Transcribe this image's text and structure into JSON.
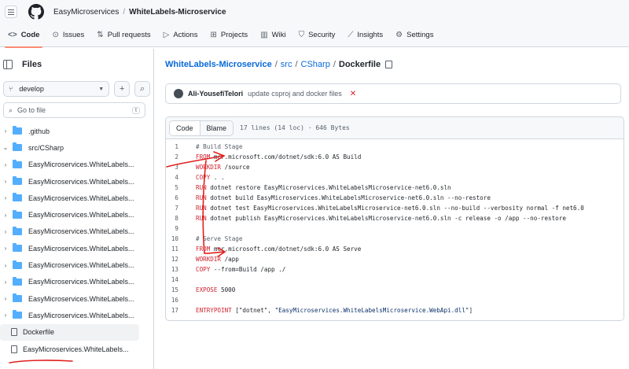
{
  "header": {
    "owner": "EasyMicroservices",
    "separator": "/",
    "repo": "WhiteLabels-Microservice"
  },
  "tabs": [
    {
      "label": "Code",
      "icon": "code-icon"
    },
    {
      "label": "Issues",
      "icon": "issue-icon"
    },
    {
      "label": "Pull requests",
      "icon": "pull-request-icon"
    },
    {
      "label": "Actions",
      "icon": "play-icon"
    },
    {
      "label": "Projects",
      "icon": "table-icon"
    },
    {
      "label": "Wiki",
      "icon": "book-icon"
    },
    {
      "label": "Security",
      "icon": "shield-icon"
    },
    {
      "label": "Insights",
      "icon": "graph-icon"
    },
    {
      "label": "Settings",
      "icon": "gear-icon"
    }
  ],
  "sidebar": {
    "title": "Files",
    "branch": "develop",
    "goto_placeholder": "Go to file",
    "goto_key": "t",
    "tree": [
      {
        "label": ".github",
        "type": "folder",
        "expanded": false
      },
      {
        "label": "src/CSharp",
        "type": "folder",
        "expanded": true
      },
      {
        "label": "EasyMicroservices.WhiteLabels...",
        "type": "folder"
      },
      {
        "label": "EasyMicroservices.WhiteLabels...",
        "type": "folder"
      },
      {
        "label": "EasyMicroservices.WhiteLabels...",
        "type": "folder"
      },
      {
        "label": "EasyMicroservices.WhiteLabels...",
        "type": "folder"
      },
      {
        "label": "EasyMicroservices.WhiteLabels...",
        "type": "folder"
      },
      {
        "label": "EasyMicroservices.WhiteLabels...",
        "type": "folder"
      },
      {
        "label": "EasyMicroservices.WhiteLabels...",
        "type": "folder"
      },
      {
        "label": "EasyMicroservices.WhiteLabels...",
        "type": "folder"
      },
      {
        "label": "EasyMicroservices.WhiteLabels...",
        "type": "folder"
      },
      {
        "label": "EasyMicroservices.WhiteLabels...",
        "type": "folder"
      },
      {
        "label": "Dockerfile",
        "type": "file"
      },
      {
        "label": "EasyMicroservices.WhiteLabels...",
        "type": "file"
      }
    ]
  },
  "breadcrumb": {
    "repo": "WhiteLabels-Microservice",
    "src": "src",
    "csharp": "CSharp",
    "file": "Dockerfile"
  },
  "commit": {
    "author": "Ali-YousefiTelori",
    "message": "update csproj and docker files",
    "status": "✕"
  },
  "code_view": {
    "code_tab": "Code",
    "blame_tab": "Blame",
    "meta": "17 lines (14 loc) · 646 Bytes",
    "lines": [
      {
        "n": "1",
        "parts": [
          {
            "c": "cm",
            "t": "# Build Stage"
          }
        ]
      },
      {
        "n": "2",
        "parts": [
          {
            "c": "kw",
            "t": "FROM"
          },
          {
            "c": "txt",
            "t": " mcr.microsoft.com/dotnet/sdk:6.0 AS Build"
          }
        ]
      },
      {
        "n": "3",
        "parts": [
          {
            "c": "kw",
            "t": "WORKDIR"
          },
          {
            "c": "txt",
            "t": " /source"
          }
        ]
      },
      {
        "n": "4",
        "parts": [
          {
            "c": "kw",
            "t": "COPY"
          },
          {
            "c": "txt",
            "t": " . ."
          }
        ]
      },
      {
        "n": "5",
        "parts": [
          {
            "c": "kw",
            "t": "RUN"
          },
          {
            "c": "txt",
            "t": " dotnet restore EasyMicroservices.WhiteLabelsMicroservice-net6.0.sln"
          }
        ]
      },
      {
        "n": "6",
        "parts": [
          {
            "c": "kw",
            "t": "RUN"
          },
          {
            "c": "txt",
            "t": " dotnet build EasyMicroservices.WhiteLabelsMicroservice-net6.0.sln --no-restore"
          }
        ]
      },
      {
        "n": "7",
        "parts": [
          {
            "c": "kw",
            "t": "RUN"
          },
          {
            "c": "txt",
            "t": " dotnet test EasyMicroservices.WhiteLabelsMicroservice-net6.0.sln --no-build --verbosity normal -f net6.0"
          }
        ]
      },
      {
        "n": "8",
        "parts": [
          {
            "c": "kw",
            "t": "RUN"
          },
          {
            "c": "txt",
            "t": " dotnet publish EasyMicroservices.WhiteLabelsMicroservice-net6.0.sln -c release -o /app --no-restore"
          }
        ]
      },
      {
        "n": "9",
        "parts": []
      },
      {
        "n": "10",
        "parts": [
          {
            "c": "cm",
            "t": "# Serve Stage"
          }
        ]
      },
      {
        "n": "11",
        "parts": [
          {
            "c": "kw",
            "t": "FROM"
          },
          {
            "c": "txt",
            "t": " mcr.microsoft.com/dotnet/sdk:6.0 AS Serve"
          }
        ]
      },
      {
        "n": "12",
        "parts": [
          {
            "c": "kw",
            "t": "WORKDIR"
          },
          {
            "c": "txt",
            "t": " /app"
          }
        ]
      },
      {
        "n": "13",
        "parts": [
          {
            "c": "kw",
            "t": "COPY"
          },
          {
            "c": "txt",
            "t": " --from=Build /app ./"
          }
        ]
      },
      {
        "n": "14",
        "parts": []
      },
      {
        "n": "15",
        "parts": [
          {
            "c": "kw",
            "t": "EXPOSE"
          },
          {
            "c": "txt",
            "t": " 5000"
          }
        ]
      },
      {
        "n": "16",
        "parts": []
      },
      {
        "n": "17",
        "parts": [
          {
            "c": "kw",
            "t": "ENTRYPOINT"
          },
          {
            "c": "txt",
            "t": " [\"dotnet\", "
          },
          {
            "c": "str",
            "t": "\"EasyMicroservices.WhiteLabelsMicroservice.WebApi.dll\""
          },
          {
            "c": "txt",
            "t": "]"
          }
        ]
      }
    ]
  },
  "colors": {
    "accent": "#0969da",
    "tab_underline": "#fd8c73",
    "keyword": "#cf222e",
    "folder": "#54aeff",
    "annotation": "#e0201f"
  }
}
